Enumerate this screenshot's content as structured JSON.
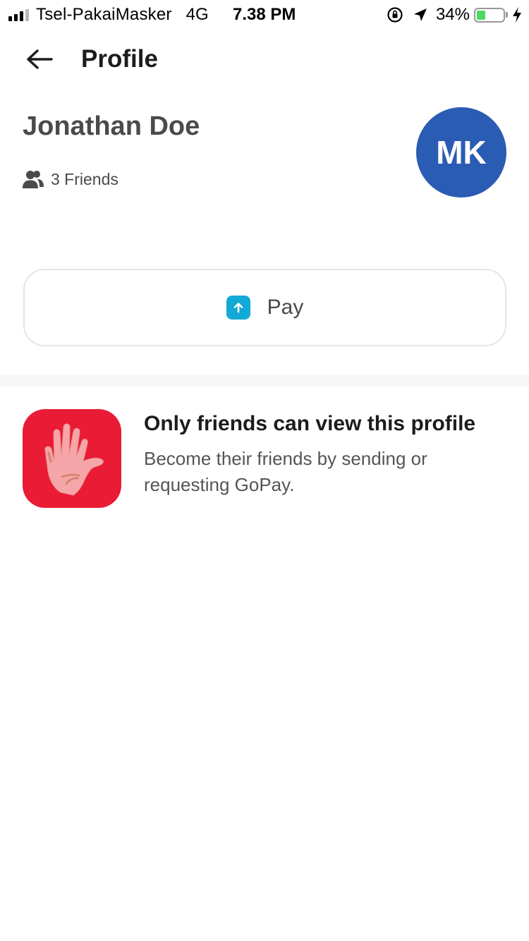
{
  "status_bar": {
    "carrier": "Tsel-PakaiMasker",
    "network": "4G",
    "time": "7.38 PM",
    "battery": "34%",
    "battery_level": 0.34,
    "icons": [
      "signal-icon",
      "orientation-lock-icon",
      "location-arrow-icon",
      "battery-icon",
      "charging-bolt-icon"
    ]
  },
  "header": {
    "title": "Profile",
    "back_icon": "arrow-left-icon"
  },
  "profile": {
    "name": "Jonathan Doe",
    "friends": "3 Friends",
    "friends_icon": "people-icon",
    "avatar_initials": "MK",
    "avatar_color": "#2b5cb4"
  },
  "pay_button": {
    "label": "Pay",
    "icon": "arrow-up-icon",
    "icon_color": "#12a9d6"
  },
  "notice": {
    "title": "Only friends can view this profile",
    "body": "Become their friends by sending or requesting GoPay.",
    "image": "raised-hand-icon",
    "image_color": "#ea1b35"
  }
}
